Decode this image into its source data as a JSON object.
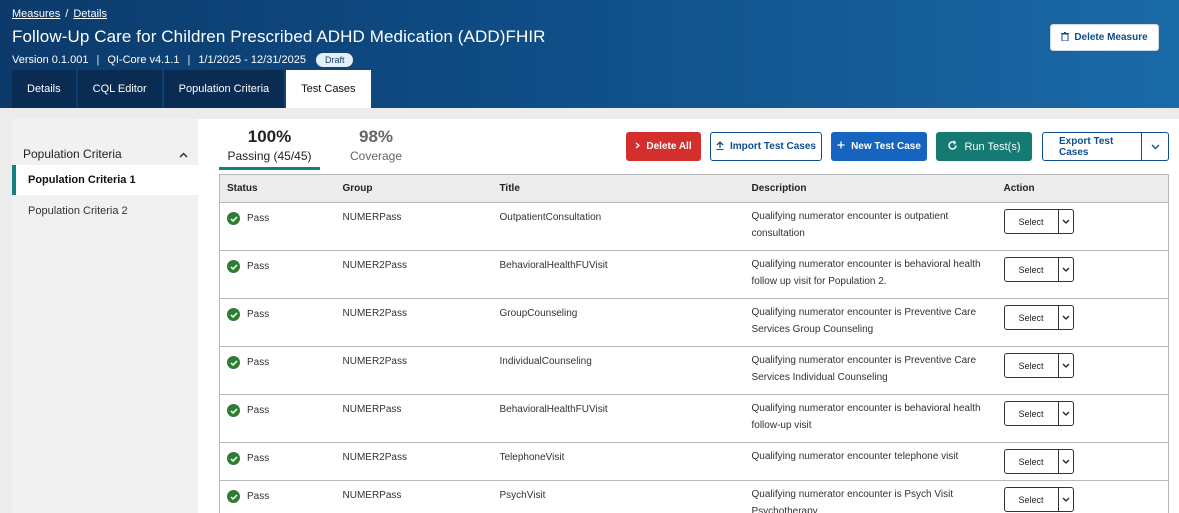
{
  "header": {
    "breadcrumb": [
      "Measures",
      "Details"
    ],
    "breadcrumb_sep": "/",
    "title": "Follow-Up Care for Children Prescribed ADHD Medication (ADD)FHIR",
    "version": "Version 0.1.001",
    "model": "QI-Core v4.1.1",
    "period": "1/1/2025 - 12/31/2025",
    "separator": "|",
    "status_badge": "Draft",
    "delete_label": "Delete Measure",
    "tabs": [
      {
        "label": "Details",
        "active": false
      },
      {
        "label": "CQL Editor",
        "active": false
      },
      {
        "label": "Population Criteria",
        "active": false
      },
      {
        "label": "Test Cases",
        "active": true
      }
    ]
  },
  "sidebar": {
    "heading": "Population Criteria",
    "items": [
      {
        "label": "Population Criteria 1",
        "active": true
      },
      {
        "label": "Population Criteria 2",
        "active": false
      }
    ]
  },
  "summary": {
    "passing_pct": "100%",
    "passing_label": "Passing (45/45)",
    "coverage_pct": "98%",
    "coverage_label": "Coverage"
  },
  "actions": {
    "delete_all": "Delete All",
    "import": "Import Test Cases",
    "new": "New Test Case",
    "run": "Run Test(s)",
    "export": "Export Test Cases"
  },
  "table": {
    "columns": [
      "Status",
      "Group",
      "Title",
      "Description",
      "Action"
    ],
    "select_label": "Select",
    "rows": [
      {
        "status": "Pass",
        "group": "NUMERPass",
        "title": "OutpatientConsultation",
        "description": "Qualifying numerator encounter is outpatient consultation"
      },
      {
        "status": "Pass",
        "group": "NUMER2Pass",
        "title": "BehavioralHealthFUVisit",
        "description": "Qualifying numerator encounter is behavioral health follow up visit for Population 2."
      },
      {
        "status": "Pass",
        "group": "NUMER2Pass",
        "title": "GroupCounseling",
        "description": "Qualifying numerator encounter is Preventive Care Services Group Counseling"
      },
      {
        "status": "Pass",
        "group": "NUMER2Pass",
        "title": "IndividualCounseling",
        "description": "Qualifying numerator encounter is Preventive Care Services Individual Counseling"
      },
      {
        "status": "Pass",
        "group": "NUMERPass",
        "title": "BehavioralHealthFUVisit",
        "description": "Qualifying numerator encounter is behavioral health follow-up visit"
      },
      {
        "status": "Pass",
        "group": "NUMER2Pass",
        "title": "TelephoneVisit",
        "description": "Qualifying numerator encounter telephone visit"
      },
      {
        "status": "Pass",
        "group": "NUMERPass",
        "title": "PsychVisit",
        "description": "Qualifying numerator encounter is Psych Visit Psychotherapy"
      }
    ]
  },
  "colors": {
    "header_dark": "#0c3a6b",
    "teal_accent": "#14807d",
    "danger": "#d32f2f",
    "primary": "#1565c0",
    "pass_green": "#2e7d32"
  }
}
